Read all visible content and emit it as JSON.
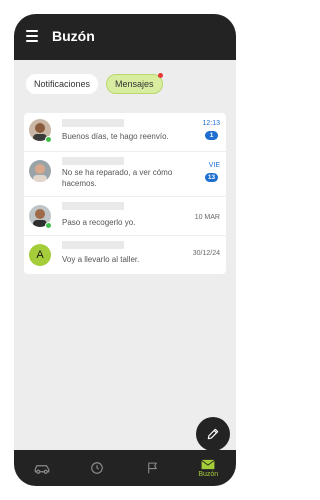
{
  "header": {
    "title": "Buzón",
    "menu_icon": "hamburger-menu-icon"
  },
  "tabs": [
    {
      "label": "Notificaciones",
      "active": false
    },
    {
      "label": "Mensajes",
      "active": true,
      "has_dot": true
    }
  ],
  "messages": [
    {
      "avatar": "photo",
      "online": true,
      "text": "Buenos días, te hago reenvío.",
      "time": "12:13",
      "unread": "1"
    },
    {
      "avatar": "photo",
      "online": false,
      "text": "No se ha reparado, a ver cómo hacemos.",
      "time": "VIE",
      "unread": "13"
    },
    {
      "avatar": "photo",
      "online": true,
      "text": "Paso a recogerlo yo.",
      "time": "10 MAR",
      "unread": ""
    },
    {
      "avatar": "A",
      "online": false,
      "text": "Voy a llevarlo al taller.",
      "time": "30/12/24",
      "unread": ""
    }
  ],
  "fab": {
    "icon": "pencil-icon"
  },
  "bottom_nav": [
    {
      "icon": "car-icon",
      "label": ""
    },
    {
      "icon": "clock-icon",
      "label": ""
    },
    {
      "icon": "flag-icon",
      "label": ""
    },
    {
      "icon": "mail-icon",
      "label": "Buzón",
      "active": true
    }
  ],
  "colors": {
    "topbar": "#232323",
    "accent": "#a5cd39",
    "unread_blue": "#1e6fd0",
    "background": "#ededed"
  }
}
